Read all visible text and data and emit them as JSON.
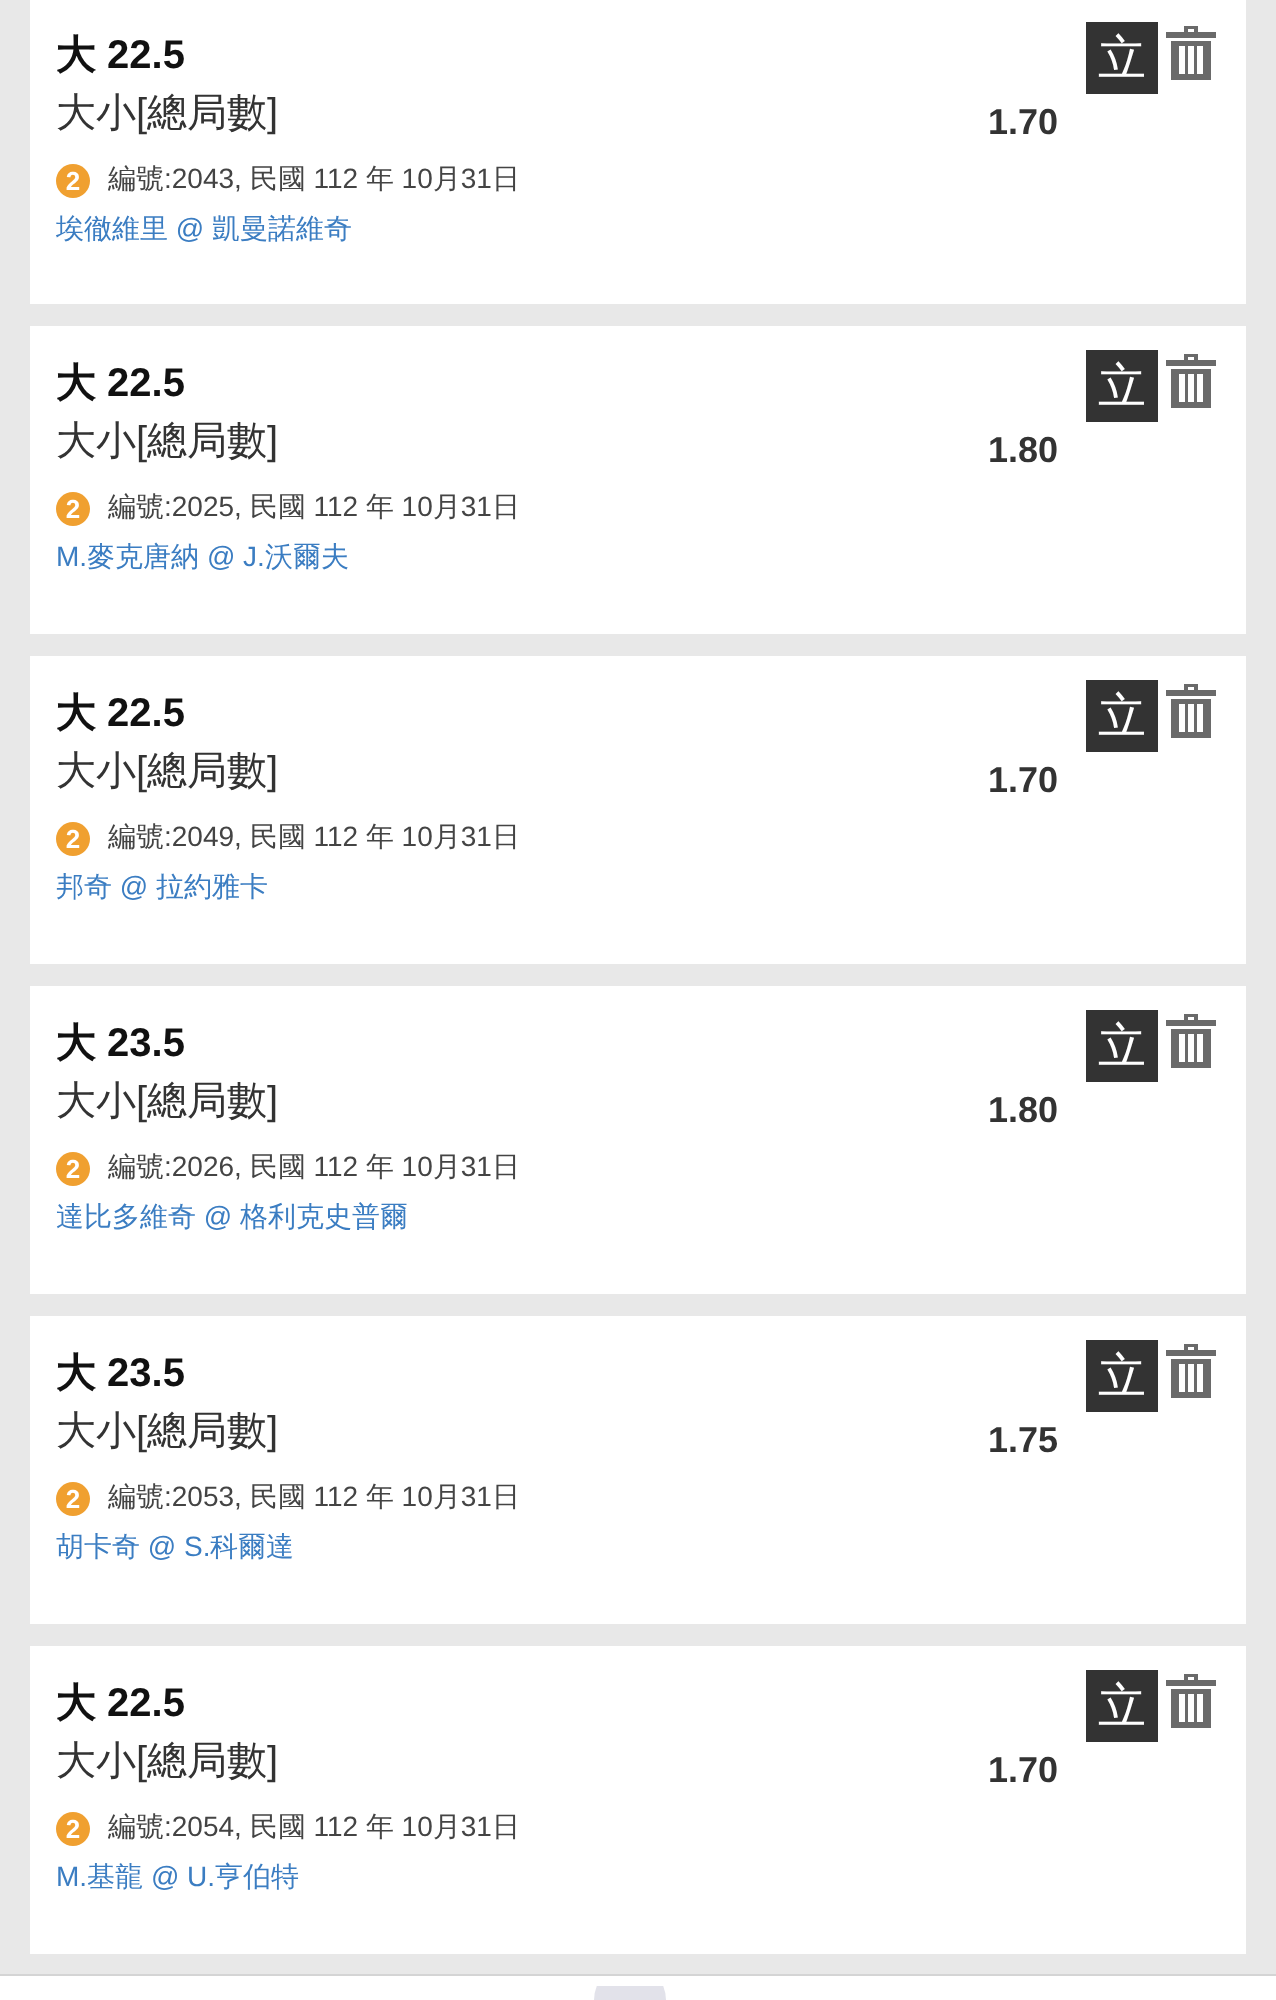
{
  "cards": [
    {
      "line": "大 22.5",
      "market": "大小[總局數]",
      "badge": "2",
      "meta": "編號:2043, 民國 112 年 10月31日",
      "teams": "埃徹維里 @ 凱曼諾維奇",
      "odds": "1.70",
      "action": "立"
    },
    {
      "line": "大 22.5",
      "market": "大小[總局數]",
      "badge": "2",
      "meta": "編號:2025, 民國 112 年 10月31日",
      "teams": "M.麥克唐納 @ J.沃爾夫",
      "odds": "1.80",
      "action": "立"
    },
    {
      "line": "大 22.5",
      "market": "大小[總局數]",
      "badge": "2",
      "meta": "編號:2049, 民國 112 年 10月31日",
      "teams": "邦奇 @ 拉約雅卡",
      "odds": "1.70",
      "action": "立"
    },
    {
      "line": "大 23.5",
      "market": "大小[總局數]",
      "badge": "2",
      "meta": "編號:2026, 民國 112 年 10月31日",
      "teams": "達比多維奇 @ 格利克史普爾",
      "odds": "1.80",
      "action": "立"
    },
    {
      "line": "大 23.5",
      "market": "大小[總局數]",
      "badge": "2",
      "meta": "編號:2053, 民國 112 年 10月31日",
      "teams": "胡卡奇 @ S.科爾達",
      "odds": "1.75",
      "action": "立"
    },
    {
      "line": "大 22.5",
      "market": "大小[總局數]",
      "badge": "2",
      "meta": "編號:2054, 民國 112 年 10月31日",
      "teams": "M.基龍 @ U.亨伯特",
      "odds": "1.70",
      "action": "立"
    }
  ]
}
